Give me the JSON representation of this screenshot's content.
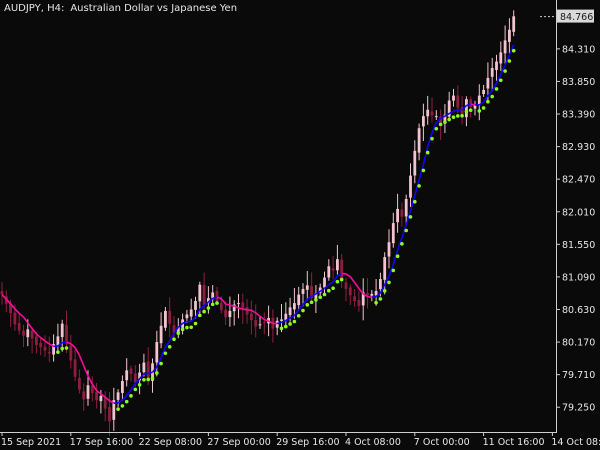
{
  "header": {
    "symbol_timeframe": "AUDJPY, H4:",
    "description": "Australian Dollar vs Japanese Yen"
  },
  "colors": {
    "background": "#0a0a0a",
    "bull_candle": "#f2c4cf",
    "bear_candle": "#8e1e40",
    "uptrend_line": "#1400ff",
    "downtrend_line": "#ff0a9c",
    "up_dots": "#88ff1e",
    "down_dots": "#ff3a3a",
    "axis_text": "#e6e6e6",
    "price_tag_bg": "#d9d9d9",
    "price_tag_text": "#1a1a1a"
  },
  "chart_data": {
    "type": "candlestick",
    "symbol": "AUDJPY",
    "timeframe": "H4",
    "y_axis": {
      "ticks": [
        84.31,
        83.85,
        83.39,
        82.93,
        82.47,
        82.01,
        81.55,
        81.09,
        80.63,
        80.17,
        79.71,
        79.25
      ],
      "tick_labels": [
        "84.310",
        "83.850",
        "83.390",
        "82.930",
        "82.470",
        "82.010",
        "81.550",
        "81.090",
        "80.630",
        "80.170",
        "79.710",
        "79.250"
      ],
      "range": [
        78.9,
        85.0
      ]
    },
    "x_axis": {
      "labels": [
        "15 Sep 2021",
        "17 Sep 16:00",
        "22 Sep 08:00",
        "27 Sep 00:00",
        "29 Sep 16:00",
        "4 Oct 08:00",
        "7 Oct 00:00",
        "11 Oct 16:00",
        "14 Oct 08:00"
      ],
      "label_bar_index": [
        0,
        16,
        32,
        48,
        64,
        80,
        96,
        112,
        128
      ]
    },
    "current_price": "84.766",
    "closes": [
      80.84,
      80.71,
      80.58,
      80.42,
      80.33,
      80.26,
      80.35,
      80.22,
      80.13,
      80.1,
      80.05,
      80.01,
      80.14,
      80.25,
      80.43,
      80.14,
      79.91,
      79.68,
      79.5,
      79.36,
      79.56,
      79.45,
      79.35,
      79.41,
      79.23,
      79.05,
      79.35,
      79.46,
      79.62,
      79.77,
      79.72,
      79.6,
      79.74,
      79.88,
      79.65,
      79.87,
      80.17,
      80.4,
      80.61,
      80.43,
      80.29,
      80.38,
      80.49,
      80.56,
      80.63,
      80.75,
      80.98,
      80.7,
      80.79,
      80.87,
      80.74,
      80.62,
      80.52,
      80.61,
      80.7,
      80.72,
      80.64,
      80.56,
      80.48,
      80.39,
      80.42,
      80.44,
      80.51,
      80.36,
      80.47,
      80.49,
      80.57,
      80.66,
      80.72,
      80.84,
      80.92,
      80.97,
      80.79,
      80.86,
      80.94,
      81.08,
      81.24,
      81.18,
      81.34,
      81.04,
      80.92,
      80.83,
      80.75,
      80.68,
      80.87,
      80.83,
      80.85,
      80.89,
      81.06,
      81.37,
      81.58,
      81.85,
      82.05,
      81.94,
      82.19,
      82.52,
      82.87,
      83.19,
      83.36,
      83.45,
      83.37,
      83.36,
      83.24,
      83.38,
      83.58,
      83.65,
      83.48,
      83.37,
      83.6,
      83.49,
      83.52,
      83.65,
      83.73,
      83.9,
      84.04,
      84.13,
      84.26,
      84.43,
      84.58,
      84.77
    ]
  }
}
